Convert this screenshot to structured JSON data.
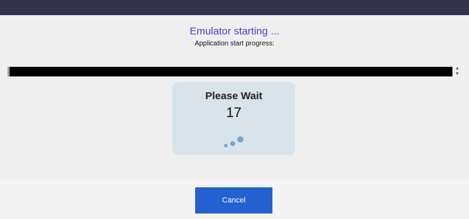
{
  "dialog": {
    "title": "Emulator starting ...",
    "subtitle": "Application start progress:",
    "progress_value": 1.0,
    "spinner_up": "▲",
    "spinner_down": "▼"
  },
  "wait_panel": {
    "heading": "Please Wait",
    "countdown": "17"
  },
  "footer": {
    "cancel_label": "Cancel"
  },
  "colors": {
    "top_bar": "#33324b",
    "title": "#4a3fcf",
    "cancel_button": "#2361cf",
    "panel": "#d8e3ea",
    "loader_dot": "#6ea8cf"
  }
}
